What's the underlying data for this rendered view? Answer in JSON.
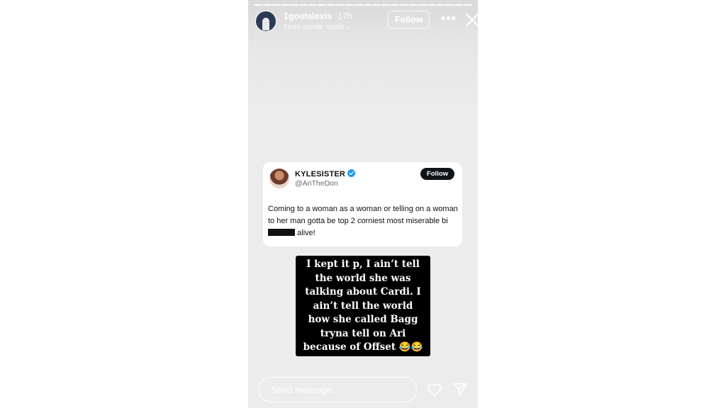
{
  "story": {
    "progress_segments": 24,
    "header": {
      "username": "1goatalexis",
      "time": "17h",
      "subtitle": "From create mode ›",
      "follow_label": "Follow",
      "more_label": "•••"
    },
    "tweet": {
      "display_name": "KYLESISTER",
      "handle": "@AriTheDon",
      "follow_label": "Follow",
      "text_part1": "Coming to a woman as a woman or telling on a woman to her man gotta be top 2 corniest most miserable bi",
      "text_part2": " alive!"
    },
    "caption_lines": [
      "I kept it p, I ain’t tell",
      "the world she was",
      "talking about Cardi. I",
      "ain’t tell the world",
      "how she called Bagg",
      "tryna tell on Ari",
      "because of Offset 😂😂"
    ],
    "footer": {
      "message_placeholder": "Send message..."
    },
    "colors": {
      "verified": "#1d9bf0",
      "caption_bg": "#000000",
      "background": "#ececec"
    }
  }
}
